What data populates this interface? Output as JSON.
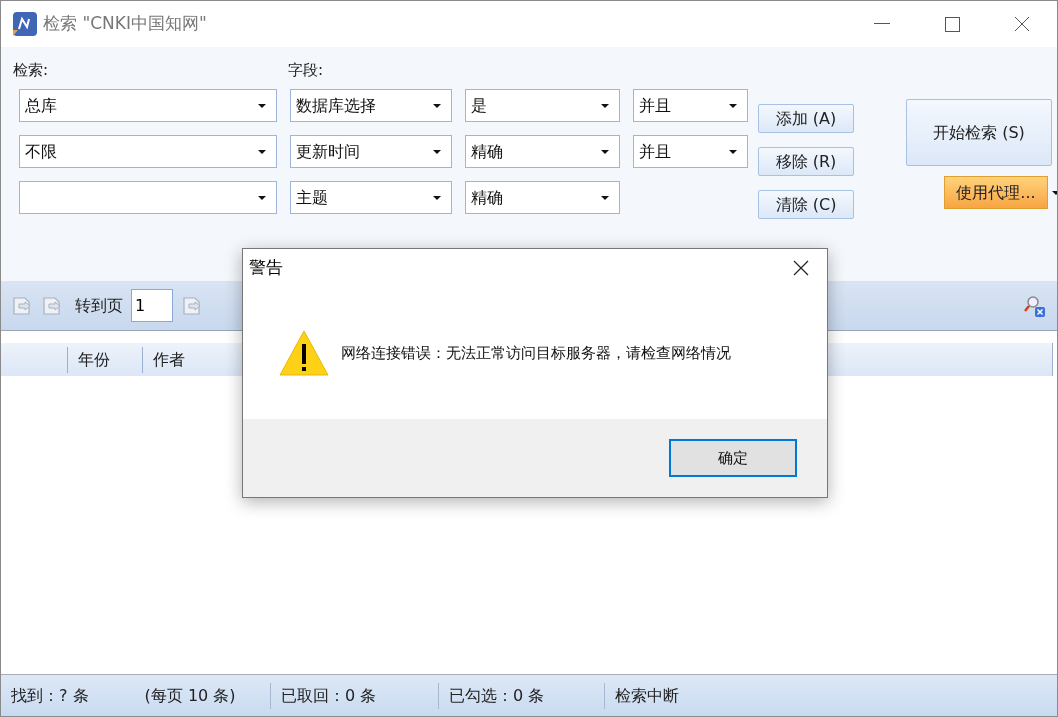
{
  "window": {
    "title": "检索 \"CNKI中国知网\""
  },
  "search_panel": {
    "search_label": "检索:",
    "field_label": "字段:",
    "rows": [
      {
        "scope": "总库",
        "field": "数据库选择",
        "match": "是",
        "logic": "并且"
      },
      {
        "scope": "不限",
        "field": "更新时间",
        "match": "精确",
        "logic": "并且"
      },
      {
        "field": "主题",
        "match": "精确"
      }
    ],
    "buttons": [
      "添加 (A)",
      "移除 (R)",
      "清除 (C)"
    ],
    "start_button": "开始检索 (S)",
    "proxy_button": "使用代理..."
  },
  "toolbar": {
    "goto_label": "转到页",
    "page_value": "1"
  },
  "table": {
    "columns": [
      "年份",
      "作者"
    ]
  },
  "dialog": {
    "title": "警告",
    "message": "网络连接错误：无法正常访问目标服务器，请检查网络情况",
    "ok_button": "确定"
  },
  "status_bar": [
    [
      "找到：? 条",
      "(每页 10 条)"
    ],
    [
      "已取回：0 条"
    ],
    [
      "已勾选：0 条"
    ],
    [
      "检索中断"
    ]
  ]
}
